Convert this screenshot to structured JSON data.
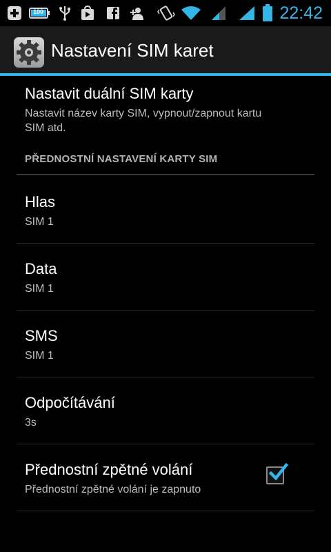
{
  "status_bar": {
    "time": "22:42",
    "icons": [
      "add-notification-icon",
      "battery-100-notification-icon",
      "usb-icon",
      "play-store-icon",
      "facebook-icon",
      "add-contact-icon",
      "vibrate-icon",
      "wifi-icon",
      "signal-sim1-icon",
      "signal-sim2-icon",
      "battery-icon"
    ],
    "battery_badge": "100",
    "accent": "#33b5e5"
  },
  "action_bar": {
    "title": "Nastavení SIM karet",
    "icon": "settings-gear-icon"
  },
  "items": {
    "dual_sim": {
      "title": "Nastavit duální SIM karty",
      "summary_line1": "Nastavit název karty SIM, vypnout/zapnout kartu",
      "summary_line2": "SIM atd."
    },
    "category": "PŘEDNOSTNÍ NASTAVENÍ KARTY SIM",
    "voice": {
      "title": "Hlas",
      "summary": "SIM 1"
    },
    "data": {
      "title": "Data",
      "summary": "SIM 1"
    },
    "sms": {
      "title": "SMS",
      "summary": "SIM 1"
    },
    "countdown": {
      "title": "Odpočítávání",
      "summary": "3s"
    },
    "callback": {
      "title": "Přednostní zpětné volání",
      "summary": "Přednostní zpětné volání je zapnuto",
      "checked": true
    }
  }
}
